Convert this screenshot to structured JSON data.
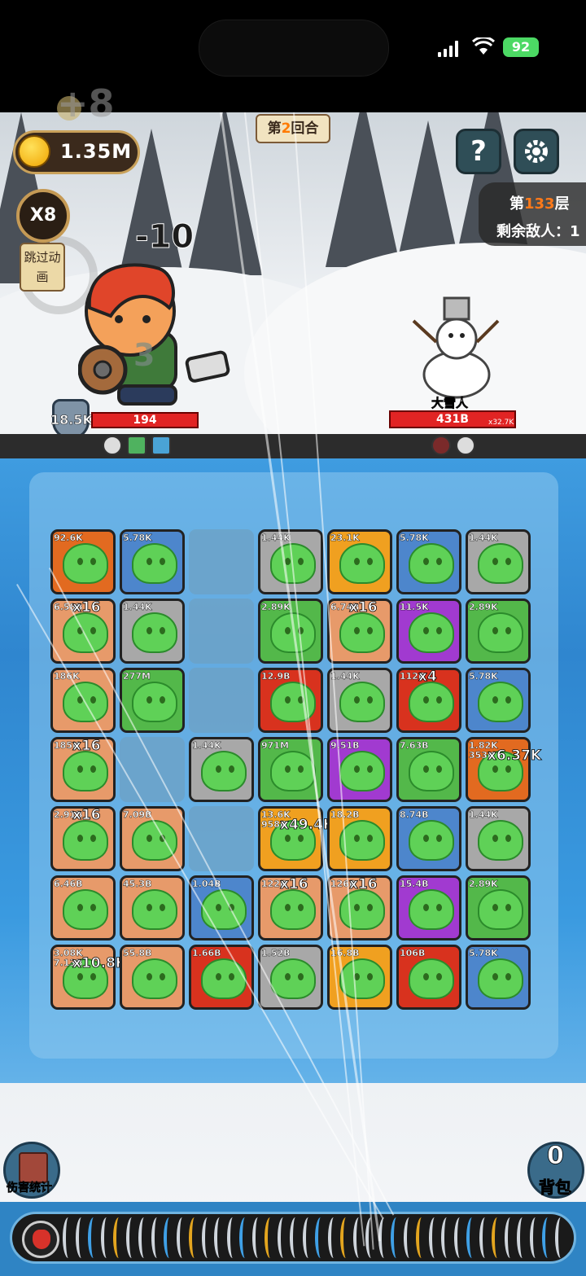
{
  "status_bar": {
    "battery": "92"
  },
  "hud": {
    "coins": "1.35M",
    "coin_gain": "+8",
    "round_prefix": "第",
    "round_num": "2",
    "round_suffix": "回合",
    "help_label": "?",
    "floor_prefix": "第",
    "floor_num": "133",
    "floor_suffix": "层",
    "enemies_left_label": "剩余敌人：1",
    "speed_label": "X8",
    "skip_label_line1": "跳过动",
    "skip_label_line2": "画"
  },
  "battle": {
    "damage_popup": "-10",
    "hero_shield": "18.5K",
    "hero_hp": "194",
    "hero_ghost_value": "3",
    "enemy_name": "大雪人",
    "enemy_hp": "431B",
    "enemy_multiplier": "x32.7K"
  },
  "board": {
    "rows": [
      [
        {
          "c": "fire",
          "v": "92.6K",
          "m": ""
        },
        {
          "c": "blue",
          "v": "5.78K",
          "m": ""
        },
        {
          "c": "empty",
          "v": "",
          "m": ""
        },
        {
          "c": "gray",
          "v": "1.44K",
          "m": ""
        },
        {
          "c": "orange",
          "v": "23.1K",
          "m": ""
        },
        {
          "c": "blue",
          "v": "5.78K",
          "m": ""
        },
        {
          "c": "gray",
          "v": "1.44K",
          "m": ""
        }
      ],
      [
        {
          "c": "pale",
          "v": "6.58B",
          "m": "x16"
        },
        {
          "c": "gray",
          "v": "1.44K",
          "m": ""
        },
        {
          "c": "empty",
          "v": "",
          "m": ""
        },
        {
          "c": "green",
          "v": "2.89K",
          "m": ""
        },
        {
          "c": "pale",
          "v": "6.74B",
          "m": "x16"
        },
        {
          "c": "purple",
          "v": "11.5K",
          "m": ""
        },
        {
          "c": "green",
          "v": "2.89K",
          "m": ""
        }
      ],
      [
        {
          "c": "pale",
          "v": "186K",
          "m": ""
        },
        {
          "c": "green",
          "v": "277M",
          "m": ""
        },
        {
          "c": "empty",
          "v": "",
          "m": ""
        },
        {
          "c": "red",
          "v": "12.9B",
          "m": ""
        },
        {
          "c": "gray",
          "v": "1.44K",
          "m": ""
        },
        {
          "c": "red",
          "v": "112B",
          "m": "x4"
        },
        {
          "c": "blue",
          "v": "5.78K",
          "m": ""
        }
      ],
      [
        {
          "c": "pale",
          "v": "185K",
          "m": "x16"
        },
        {
          "c": "empty",
          "v": "",
          "m": ""
        },
        {
          "c": "gray",
          "v": "1.44K",
          "m": ""
        },
        {
          "c": "green",
          "v": "971M",
          "m": ""
        },
        {
          "c": "purple",
          "v": "9.51B",
          "m": ""
        },
        {
          "c": "green",
          "v": "7.63B",
          "m": ""
        },
        {
          "c": "fire",
          "v": "1.82K",
          "m": "x6.37K",
          "v2": "353K"
        }
      ],
      [
        {
          "c": "pale",
          "v": "2.91B",
          "m": "x16"
        },
        {
          "c": "pale",
          "v": "7.09B",
          "m": ""
        },
        {
          "c": "empty",
          "v": "",
          "m": ""
        },
        {
          "c": "orange",
          "v": "13.6K",
          "m": "x49.4K",
          "v2": "958B"
        },
        {
          "c": "orange",
          "v": "18.2B",
          "m": ""
        },
        {
          "c": "blue",
          "v": "8.74B",
          "m": ""
        },
        {
          "c": "gray",
          "v": "1.44K",
          "m": ""
        }
      ],
      [
        {
          "c": "pale",
          "v": "6.46B",
          "m": ""
        },
        {
          "c": "pale",
          "v": "45.3B",
          "m": ""
        },
        {
          "c": "blue",
          "v": "1.04B",
          "m": ""
        },
        {
          "c": "pale",
          "v": "122B",
          "m": "x16"
        },
        {
          "c": "pale",
          "v": "126B",
          "m": "x16"
        },
        {
          "c": "purple",
          "v": "15.4B",
          "m": ""
        },
        {
          "c": "green",
          "v": "2.89K",
          "m": ""
        }
      ],
      [
        {
          "c": "pale",
          "v": "3.08K",
          "m": "x10.8K",
          "v2": "7.13B"
        },
        {
          "c": "pale",
          "v": "55.8B",
          "m": ""
        },
        {
          "c": "red",
          "v": "1.66B",
          "m": ""
        },
        {
          "c": "gray",
          "v": "1.52B",
          "m": ""
        },
        {
          "c": "orange",
          "v": "16.8B",
          "m": ""
        },
        {
          "c": "red",
          "v": "106B",
          "m": ""
        },
        {
          "c": "blue",
          "v": "5.78K",
          "m": ""
        }
      ]
    ]
  },
  "bottom": {
    "damage_stats_label": "伤害统计",
    "bag_count": "0",
    "bag_label": "背包"
  },
  "colors": {
    "blue": "#4d86cc",
    "gray": "#a8a8a8",
    "orange": "#f0a020",
    "red": "#d8321e",
    "purple": "#a13ad0",
    "green": "#53b84a",
    "pale": "#e79a6a",
    "fire": "#e26a20"
  }
}
